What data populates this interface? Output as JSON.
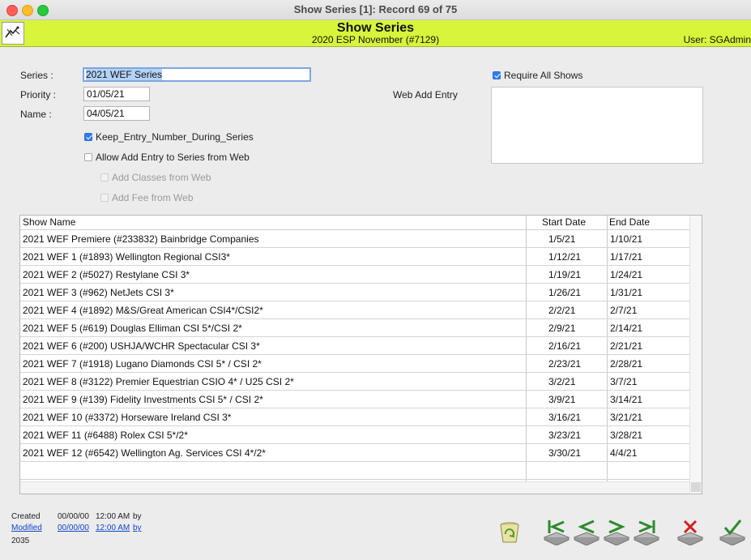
{
  "window": {
    "title": "Show Series [1]: Record 69 of 75"
  },
  "header": {
    "title": "Show Series",
    "subtitle": "2020 ESP November (#7129)",
    "user_label": "User: SGAdmin",
    "bg_color": "#d9f53b"
  },
  "form": {
    "series_label": "Series :",
    "series_value": "2021 WEF Series",
    "priority_label": "Priority :",
    "priority_value": "01/05/21",
    "name_label": "Name :",
    "name_value": "04/05/21",
    "keep_entry_label": "Keep_Entry_Number_During_Series",
    "keep_entry_checked": true,
    "allow_add_label": "Allow Add Entry to Series from Web",
    "allow_add_checked": false,
    "add_classes_label": "Add Classes from Web",
    "add_fee_label": "Add Fee from Web",
    "require_all_label": "Require All Shows",
    "require_all_checked": true,
    "web_add_entry_label": "Web Add Entry"
  },
  "table": {
    "columns": [
      "Show Name",
      "Start Date",
      "End Date"
    ],
    "rows": [
      [
        "2021 WEF Premiere (#233832) Bainbridge Companies",
        "1/5/21",
        "1/10/21"
      ],
      [
        "2021 WEF 1 (#1893) Wellington Regional CSI3*",
        "1/12/21",
        "1/17/21"
      ],
      [
        "2021 WEF 2 (#5027) Restylane CSI 3*",
        "1/19/21",
        "1/24/21"
      ],
      [
        "2021 WEF 3 (#962) NetJets CSI 3*",
        "1/26/21",
        "1/31/21"
      ],
      [
        "2021 WEF 4 (#1892) M&S/Great American CSI4*/CSI2*",
        "2/2/21",
        "2/7/21"
      ],
      [
        "2021 WEF 5 (#619) Douglas Elliman CSI 5*/CSI 2*",
        "2/9/21",
        "2/14/21"
      ],
      [
        "2021 WEF 6 (#200) USHJA/WCHR Spectacular CSI 3*",
        "2/16/21",
        "2/21/21"
      ],
      [
        "2021 WEF 7 (#1918) Lugano Diamonds CSI 5* / CSI 2*",
        "2/23/21",
        "2/28/21"
      ],
      [
        "2021 WEF 8 (#3122) Premier Equestrian CSIO 4* / U25 CSI 2*",
        "3/2/21",
        "3/7/21"
      ],
      [
        "2021 WEF 9 (#139) Fidelity Investments CSI 5* / CSI 2*",
        "3/9/21",
        "3/14/21"
      ],
      [
        "2021 WEF 10 (#3372) Horseware Ireland CSI 3*",
        "3/16/21",
        "3/21/21"
      ],
      [
        "2021 WEF 11 (#6488) Rolex CSI 5*/2*",
        "3/23/21",
        "3/28/21"
      ],
      [
        "2021 WEF 12 (#6542) Wellington Ag. Services CSI 4*/2*",
        "3/30/21",
        "4/4/21"
      ]
    ]
  },
  "footer": {
    "created_label": "Created",
    "created_date": "00/00/00",
    "created_time": "12:00 AM",
    "created_by": "by",
    "modified_label": "Modified",
    "modified_date": "00/00/00",
    "modified_time": "12:00 AM",
    "modified_by": "by",
    "record_id": "2035"
  },
  "toolbar": {
    "icons": [
      "trash-icon",
      "first-record-icon",
      "previous-record-icon",
      "next-record-icon",
      "last-record-icon",
      "cancel-icon",
      "accept-icon"
    ]
  }
}
